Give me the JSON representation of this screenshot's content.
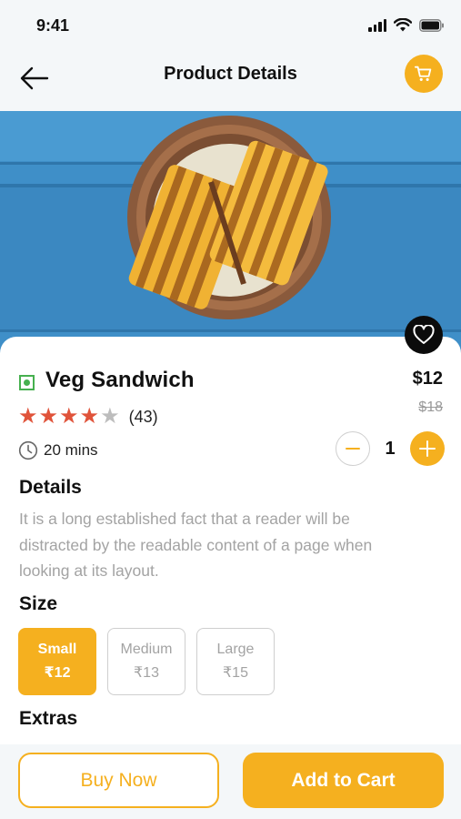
{
  "status_bar": {
    "time": "9:41"
  },
  "header": {
    "title": "Product Details"
  },
  "product": {
    "name": "Veg Sandwich",
    "price": "$12",
    "old_price": "$18",
    "rating": 4,
    "rating_max": 5,
    "reviews": "(43)",
    "prep_time": "20 mins",
    "quantity": "1"
  },
  "details": {
    "title": "Details",
    "text": "It is a long established fact that a reader will be distracted by the readable content of a page when looking at its layout."
  },
  "size": {
    "title": "Size",
    "options": [
      {
        "label": "Small",
        "price": "₹12",
        "selected": true
      },
      {
        "label": "Medium",
        "price": "₹13",
        "selected": false
      },
      {
        "label": "Large",
        "price": "₹15",
        "selected": false
      }
    ]
  },
  "extras": {
    "title": "Extras"
  },
  "actions": {
    "buy_now": "Buy Now",
    "add_to_cart": "Add to Cart"
  },
  "colors": {
    "accent": "#f5b01f",
    "star": "#e0533a",
    "veg": "#46b04f",
    "muted_text": "#a3a3a3",
    "table_blue": "#3d8fc9"
  },
  "icons": [
    "back-arrow-icon",
    "cart-icon",
    "heart-icon",
    "veg-icon",
    "star-icon",
    "clock-icon",
    "minus-icon",
    "plus-icon",
    "signal-icon",
    "wifi-icon",
    "battery-icon"
  ]
}
